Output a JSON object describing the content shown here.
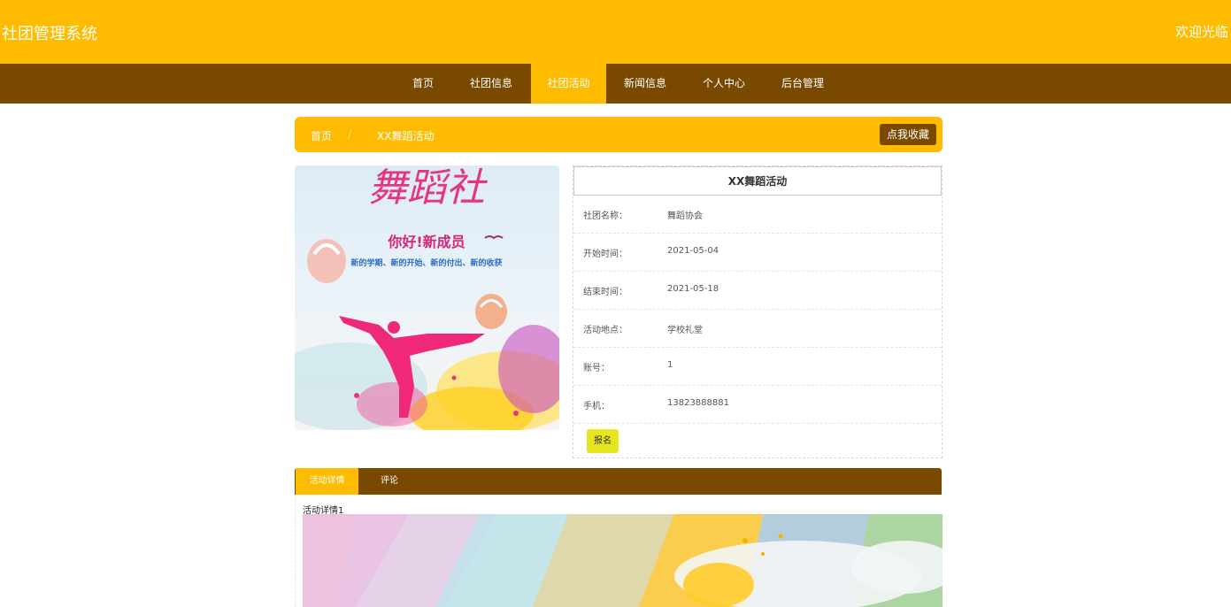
{
  "header": {
    "brand": "社团管理系统",
    "welcome": "欢迎光临"
  },
  "nav": {
    "items": [
      "首页",
      "社团信息",
      "社团活动",
      "新闻信息",
      "个人中心",
      "后台管理"
    ],
    "active_index": 2
  },
  "breadcrumb": {
    "home": "首页",
    "separator": "/",
    "current": "XX舞蹈活动",
    "favorite_button": "点我收藏"
  },
  "poster": {
    "title": "舞蹈社",
    "greeting": "你好!新成员",
    "slogan": "新的学期、新的开始、新的付出、新的收获"
  },
  "activity": {
    "title": "XX舞蹈活动",
    "fields": [
      {
        "label": "社团名称：",
        "value": "舞蹈协会"
      },
      {
        "label": "开始时间：",
        "value": "2021-05-04"
      },
      {
        "label": "结束时间：",
        "value": "2021-05-18"
      },
      {
        "label": "活动地点：",
        "value": "学校礼堂"
      },
      {
        "label": "账号：",
        "value": "1"
      },
      {
        "label": "手机：",
        "value": "13823888881"
      }
    ],
    "signup_button": "报名"
  },
  "tabs": {
    "items": [
      "活动详情",
      "评论"
    ],
    "active_index": 0
  },
  "detail": {
    "text": "活动详情1"
  },
  "colors": {
    "primary": "#FFBB00",
    "secondary": "#7A4900",
    "signup": "#E6E61E"
  }
}
